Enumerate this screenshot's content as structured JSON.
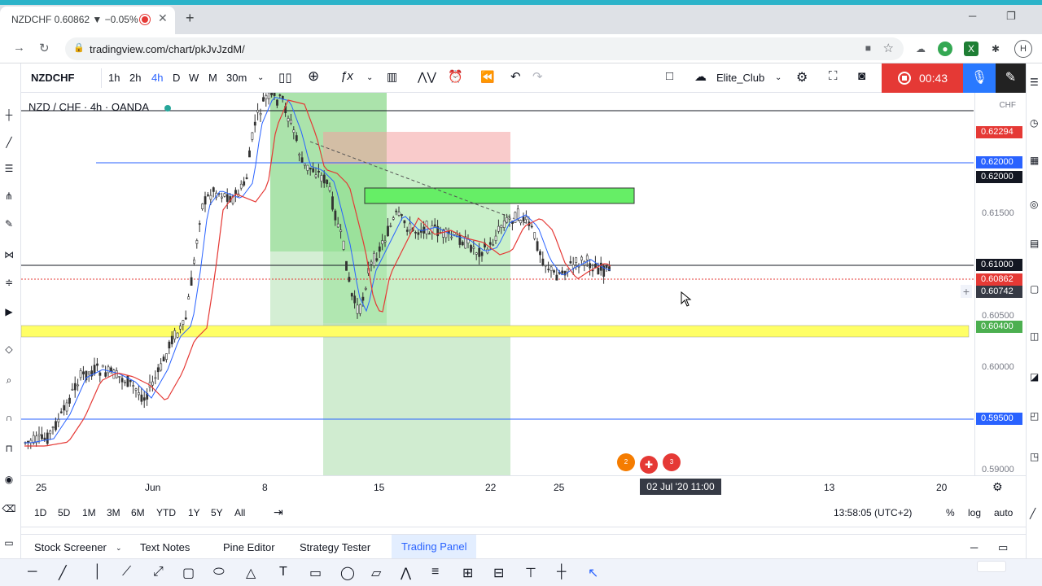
{
  "browser": {
    "tab_title": "NZDCHF 0.60862 ▼ −0.05%",
    "url": "tradingview.com/chart/pkJvJzdM/",
    "profile_initial": "H"
  },
  "header": {
    "symbol": "NZDCHF",
    "intervals": [
      "1h",
      "2h",
      "4h",
      "D",
      "W",
      "M",
      "30m"
    ],
    "active_interval": "4h",
    "layout_name": "Elite_Club",
    "record_time": "00:43"
  },
  "legend": {
    "text": "NZD / CHF · 4h · OANDA"
  },
  "price_scale": {
    "currency": "CHF",
    "ticks": [
      "0.61500",
      "0.60500",
      "0.60000",
      "0.59000"
    ],
    "labels": [
      {
        "text": "0.62294",
        "color": "#e53935"
      },
      {
        "text": "0.62000",
        "color": "#2962ff"
      },
      {
        "text": "0.62000",
        "color": "#131722"
      },
      {
        "text": "0.61000",
        "color": "#131722"
      },
      {
        "text": "0.60862",
        "color": "#e53935"
      },
      {
        "text": "0.60742",
        "color": "#363a45"
      },
      {
        "text": "0.60400",
        "color": "#4caf50"
      },
      {
        "text": "0.59500",
        "color": "#2962ff"
      }
    ]
  },
  "time_scale": {
    "ticks": [
      "25",
      "Jun",
      "8",
      "15",
      "22",
      "25",
      "13",
      "20"
    ],
    "crosshair_label": "02 Jul '20   11:00"
  },
  "range_bar": {
    "ranges": [
      "1D",
      "5D",
      "1M",
      "3M",
      "6M",
      "YTD",
      "1Y",
      "5Y",
      "All"
    ],
    "clock": "13:58:05 (UTC+2)",
    "percent": "%",
    "log": "log",
    "auto": "auto"
  },
  "bottom_panel": {
    "tabs": [
      "Stock Screener",
      "Text Notes",
      "Pine Editor",
      "Strategy Tester",
      "Trading Panel"
    ],
    "active_tab": "Trading Panel"
  },
  "events": [
    "2",
    "",
    "3"
  ],
  "colors": {
    "up": "#26a69a",
    "down": "#333333",
    "ema_fast": "#2962ff",
    "ema_slow": "#e53935",
    "zone_yellow": "#ffff66",
    "zone_green": "#66ee66",
    "record": "#e53935"
  }
}
